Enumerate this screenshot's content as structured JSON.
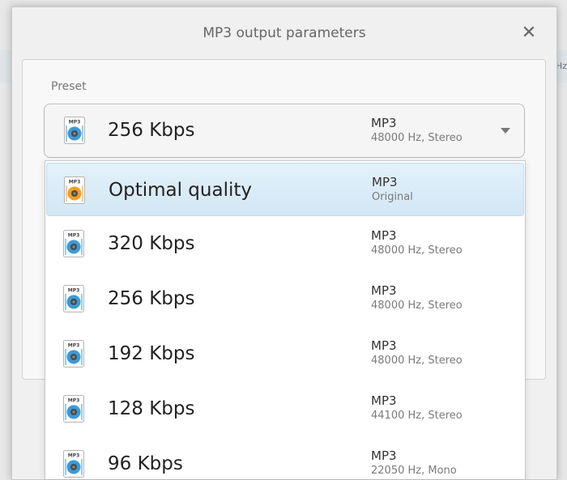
{
  "background": {
    "hz_fragment": "Hz"
  },
  "dialog": {
    "title": "MP3 output parameters",
    "close_icon": "close-icon",
    "preset_label": "Preset",
    "selected": {
      "name": "256 Kbps",
      "format": "MP3",
      "details": "48000 Hz,  Stereo",
      "icon": "mp3-file-icon"
    }
  },
  "options": [
    {
      "name": "Optimal quality",
      "format": "MP3",
      "details": "Original",
      "icon": "mp3-file-orange-icon",
      "selected": true
    },
    {
      "name": "320 Kbps",
      "format": "MP3",
      "details": "48000 Hz,  Stereo",
      "icon": "mp3-file-icon"
    },
    {
      "name": "256 Kbps",
      "format": "MP3",
      "details": "48000 Hz,  Stereo",
      "icon": "mp3-file-icon"
    },
    {
      "name": "192 Kbps",
      "format": "MP3",
      "details": "48000 Hz,  Stereo",
      "icon": "mp3-file-icon"
    },
    {
      "name": "128 Kbps",
      "format": "MP3",
      "details": "44100 Hz,  Stereo",
      "icon": "mp3-file-icon"
    },
    {
      "name": "96 Kbps",
      "format": "MP3",
      "details": "22050 Hz,  Mono",
      "icon": "mp3-file-icon"
    }
  ],
  "colors": {
    "accent_blue": "#3b9bd6",
    "accent_orange": "#f0a020",
    "selection": "#d8ebf8"
  }
}
